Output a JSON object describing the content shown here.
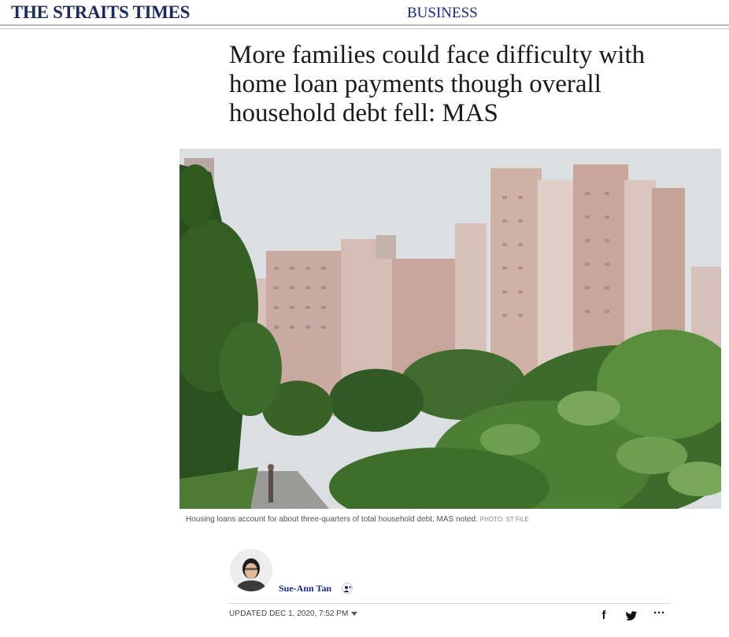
{
  "masthead": {
    "logo": "THE STRAITS TIMES",
    "section": "BUSINESS"
  },
  "article": {
    "headline": "More families could face difficulty with home loan payments though overall household debt fell: MAS",
    "caption": "Housing loans account for about three-quarters of total household debt, MAS noted.",
    "photo_credit": "PHOTO: ST FILE",
    "author": "Sue-Ann Tan",
    "updated_label": "UPDATED",
    "updated_time": "DEC 1, 2020, 7:52 PM"
  },
  "share": {
    "facebook_glyph": "f",
    "more_glyph": "···"
  },
  "colors": {
    "brand": "#1b2a5a",
    "section": "#1b2a7a",
    "text": "#1a1a1a"
  }
}
